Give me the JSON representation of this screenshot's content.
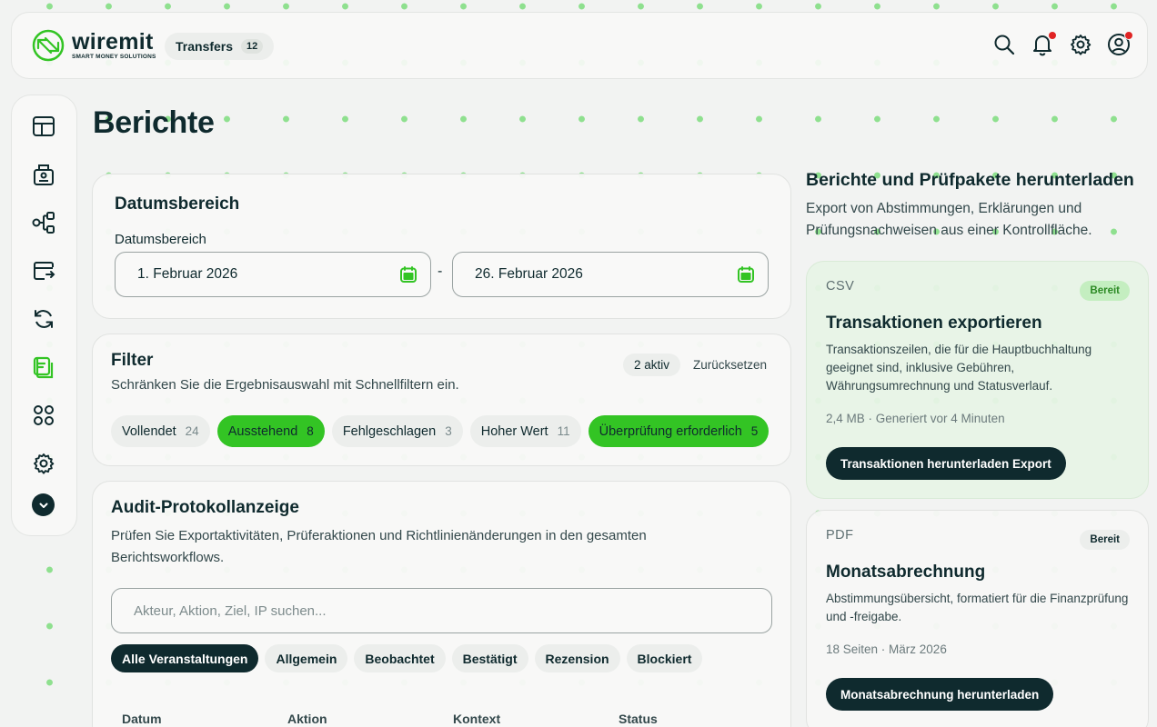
{
  "brand": {
    "name": "wiremit",
    "tagline": "SMART MONEY SOLUTIONS",
    "accent": "#33c424",
    "dark": "#0f2a2e"
  },
  "topbar": {
    "transfers_label": "Transfers",
    "transfers_count": "12",
    "icons": [
      "search-icon",
      "bell-icon",
      "gear-icon",
      "user-icon"
    ]
  },
  "sidebar": {
    "items": [
      "layout-icon",
      "safe-icon",
      "workflow-icon",
      "wallet-transfer-icon",
      "refresh-icon",
      "reports-icon",
      "grid-icon",
      "settings-icon",
      "chevron-down-icon"
    ],
    "active": "reports-icon"
  },
  "page": {
    "title": "Berichte"
  },
  "date_range": {
    "card_title": "Datumsbereich",
    "field_label": "Datumsbereich",
    "from": "1. Februar 2026",
    "separator": "-",
    "to": "26. Februar 2026"
  },
  "filter": {
    "title": "Filter",
    "description": "Schränken Sie die Ergebnisauswahl mit Schnellfiltern ein.",
    "active_label": "2 aktiv",
    "reset_label": "Zurücksetzen",
    "chips": [
      {
        "label": "Vollendet",
        "count": "24",
        "active": false
      },
      {
        "label": "Ausstehend",
        "count": "8",
        "active": true
      },
      {
        "label": "Fehlgeschlagen",
        "count": "3",
        "active": false
      },
      {
        "label": "Hoher Wert",
        "count": "11",
        "active": false
      },
      {
        "label": "Überprüfung erforderlich",
        "count": "5",
        "active": true
      }
    ]
  },
  "audit": {
    "title": "Audit-Protokollanzeige",
    "description": "Prüfen Sie Exportaktivitäten, Prüferaktionen und Richtlinienänderungen in den gesamten Berichtsworkflows.",
    "search_placeholder": "Akteur, Aktion, Ziel, IP suchen...",
    "search_value": "",
    "tabs": [
      {
        "label": "Alle Veranstaltungen",
        "active": true
      },
      {
        "label": "Allgemein",
        "active": false
      },
      {
        "label": "Beobachtet",
        "active": false
      },
      {
        "label": "Bestätigt",
        "active": false
      },
      {
        "label": "Rezension",
        "active": false
      },
      {
        "label": "Blockiert",
        "active": false
      }
    ],
    "columns": [
      "Datum",
      "Aktion",
      "Kontext",
      "Status"
    ]
  },
  "downloads": {
    "title": "Berichte und Prüfpakete herunterladen",
    "description": "Export von Abstimmungen, Erklärungen und Prüfungsnachweisen aus einer Kontrollfläche.",
    "cards": [
      {
        "format": "CSV",
        "badge": "Bereit",
        "title": "Transaktionen exportieren",
        "description": "Transaktionszeilen, die für die Hauptbuchhaltung geeignet sind, inklusive Gebühren, Währungsumrechnung und Statusverlauf.",
        "meta": "2,4 MB · Generiert vor 4 Minuten",
        "button": "Transaktionen herunterladen Export"
      },
      {
        "format": "PDF",
        "badge": "Bereit",
        "title": "Monatsabrechnung",
        "description": "Abstimmungsübersicht, formatiert für die Finanzprüfung und -freigabe.",
        "meta": "18 Seiten · März 2026",
        "button": "Monatsabrechnung herunterladen"
      }
    ]
  }
}
